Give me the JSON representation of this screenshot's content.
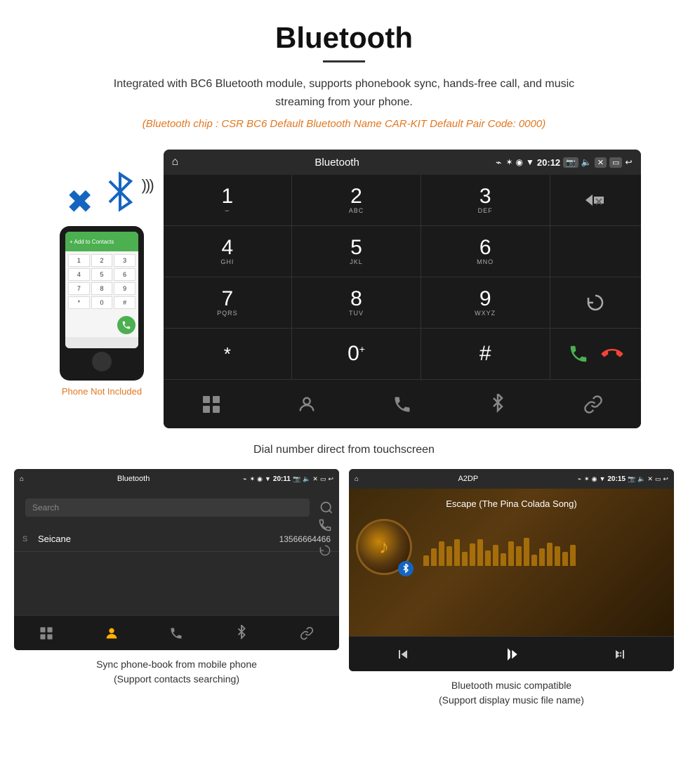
{
  "header": {
    "title": "Bluetooth",
    "description": "Integrated with BC6 Bluetooth module, supports phonebook sync, hands-free call, and music streaming from your phone.",
    "specs": "(Bluetooth chip : CSR BC6    Default Bluetooth Name CAR-KIT    Default Pair Code: 0000)"
  },
  "phone_mockup": {
    "not_included": "Phone Not Included",
    "keys": [
      [
        "1",
        "2",
        "3"
      ],
      [
        "4",
        "5",
        "6"
      ],
      [
        "7",
        "8",
        "9"
      ],
      [
        "*",
        "0",
        "#"
      ]
    ]
  },
  "main_screen": {
    "statusbar": {
      "home_icon": "⌂",
      "title": "Bluetooth",
      "usb_icon": "⌁",
      "time": "20:12"
    },
    "dialpad": {
      "keys": [
        {
          "num": "1",
          "letters": "∞"
        },
        {
          "num": "2",
          "letters": "ABC"
        },
        {
          "num": "3",
          "letters": "DEF"
        },
        {
          "num": "4",
          "letters": "GHI"
        },
        {
          "num": "5",
          "letters": "JKL"
        },
        {
          "num": "6",
          "letters": "MNO"
        },
        {
          "num": "7",
          "letters": "PQRS"
        },
        {
          "num": "8",
          "letters": "TUV"
        },
        {
          "num": "9",
          "letters": "WXYZ"
        },
        {
          "num": "*",
          "letters": ""
        },
        {
          "num": "0",
          "letters": "+"
        },
        {
          "num": "#",
          "letters": ""
        }
      ]
    },
    "caption": "Dial number direct from touchscreen"
  },
  "phonebook_screen": {
    "statusbar": {
      "home_icon": "⌂",
      "title": "Bluetooth",
      "usb_icon": "⌁",
      "time": "20:11"
    },
    "search_placeholder": "Search",
    "contact": {
      "letter": "S",
      "name": "Seicane",
      "number": "13566664466"
    },
    "caption_line1": "Sync phone-book from mobile phone",
    "caption_line2": "(Support contacts searching)"
  },
  "music_screen": {
    "statusbar": {
      "home_icon": "⌂",
      "title": "A2DP",
      "usb_icon": "⌁",
      "time": "20:15"
    },
    "song_title": "Escape (The Pina Colada Song)",
    "visualizer_bars": [
      15,
      25,
      35,
      28,
      40,
      20,
      32,
      38,
      22,
      30,
      18,
      35,
      28,
      40,
      15,
      25,
      35,
      28,
      20,
      32
    ],
    "caption_line1": "Bluetooth music compatible",
    "caption_line2": "(Support display music file name)"
  },
  "colors": {
    "orange": "#e07820",
    "green": "#4caf50",
    "red": "#f44336",
    "blue": "#1565c0"
  }
}
